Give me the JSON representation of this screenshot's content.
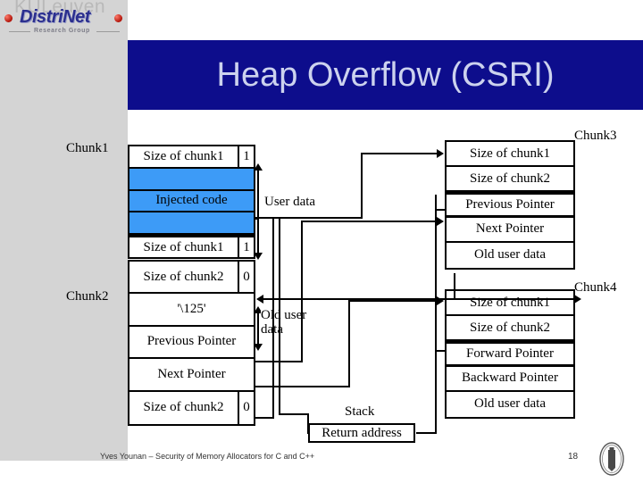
{
  "slide": {
    "title": "Heap Overflow (CSRI)",
    "banner_color": "#0d0d8c",
    "title_color": "#ccd2ee",
    "highlight_color": "#3d9bf7"
  },
  "logo": {
    "ghost_text": "KULeuven",
    "brand": "DistriNet",
    "subtitle": "Research Group"
  },
  "captions": {
    "chunk1": "Chunk1",
    "chunk2": "Chunk2",
    "chunk3": "Chunk3",
    "chunk4": "Chunk4",
    "user_data": "User data",
    "old_user_data": "Old user\ndata",
    "stack": "Stack",
    "return_address": "Return address"
  },
  "chunk1": {
    "rows": [
      {
        "label": "Size of chunk1",
        "flag": "1",
        "blue": false
      },
      {
        "label": "",
        "flag": "",
        "blue": true
      },
      {
        "label": "Injected code",
        "flag": "",
        "blue": true
      },
      {
        "label": "",
        "flag": "",
        "blue": true
      },
      {
        "label": "Size of chunk1",
        "flag": "1",
        "blue": false
      }
    ]
  },
  "chunk2": {
    "rows": [
      {
        "label": "Size of chunk2",
        "flag": "0",
        "blue": false
      },
      {
        "label": "'\\125'",
        "flag": "",
        "blue": false
      },
      {
        "label": "Previous Pointer",
        "flag": "",
        "blue": false
      },
      {
        "label": "Next Pointer",
        "flag": "",
        "blue": false
      },
      {
        "label": "Size of chunk2",
        "flag": "0",
        "blue": false
      }
    ]
  },
  "chunk3": {
    "rows": [
      {
        "label": "Size of chunk1"
      },
      {
        "label": "Size of chunk2"
      },
      {
        "label": "Previous Pointer"
      },
      {
        "label": "Next Pointer"
      },
      {
        "label": "Old user data"
      }
    ]
  },
  "chunk4": {
    "rows": [
      {
        "label": "Size of chunk1"
      },
      {
        "label": "Size of chunk2"
      },
      {
        "label": "Forward Pointer"
      },
      {
        "label": "Backward Pointer"
      },
      {
        "label": "Old user data"
      }
    ]
  },
  "footer": {
    "credit": "Yves Younan – Security of Memory Allocators for C and C++",
    "page": "18"
  }
}
